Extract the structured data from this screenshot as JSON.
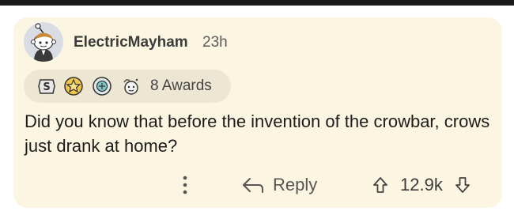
{
  "comment": {
    "author": "ElectricMayham",
    "time_ago": "23h",
    "awards_label": "8 Awards",
    "body": "Did you know that before the invention of the crowbar, crows just drank at home?",
    "reply_label": "Reply",
    "score": "12.9k"
  },
  "awards": [
    {
      "icon": "silver-award-icon"
    },
    {
      "icon": "gold-award-icon"
    },
    {
      "icon": "platinum-award-icon"
    },
    {
      "icon": "wholesome-award-icon"
    }
  ],
  "colors": {
    "card_background": "#fbf5e1",
    "awards_pill_background": "#ece6d2",
    "text": "#1c1c1c"
  }
}
